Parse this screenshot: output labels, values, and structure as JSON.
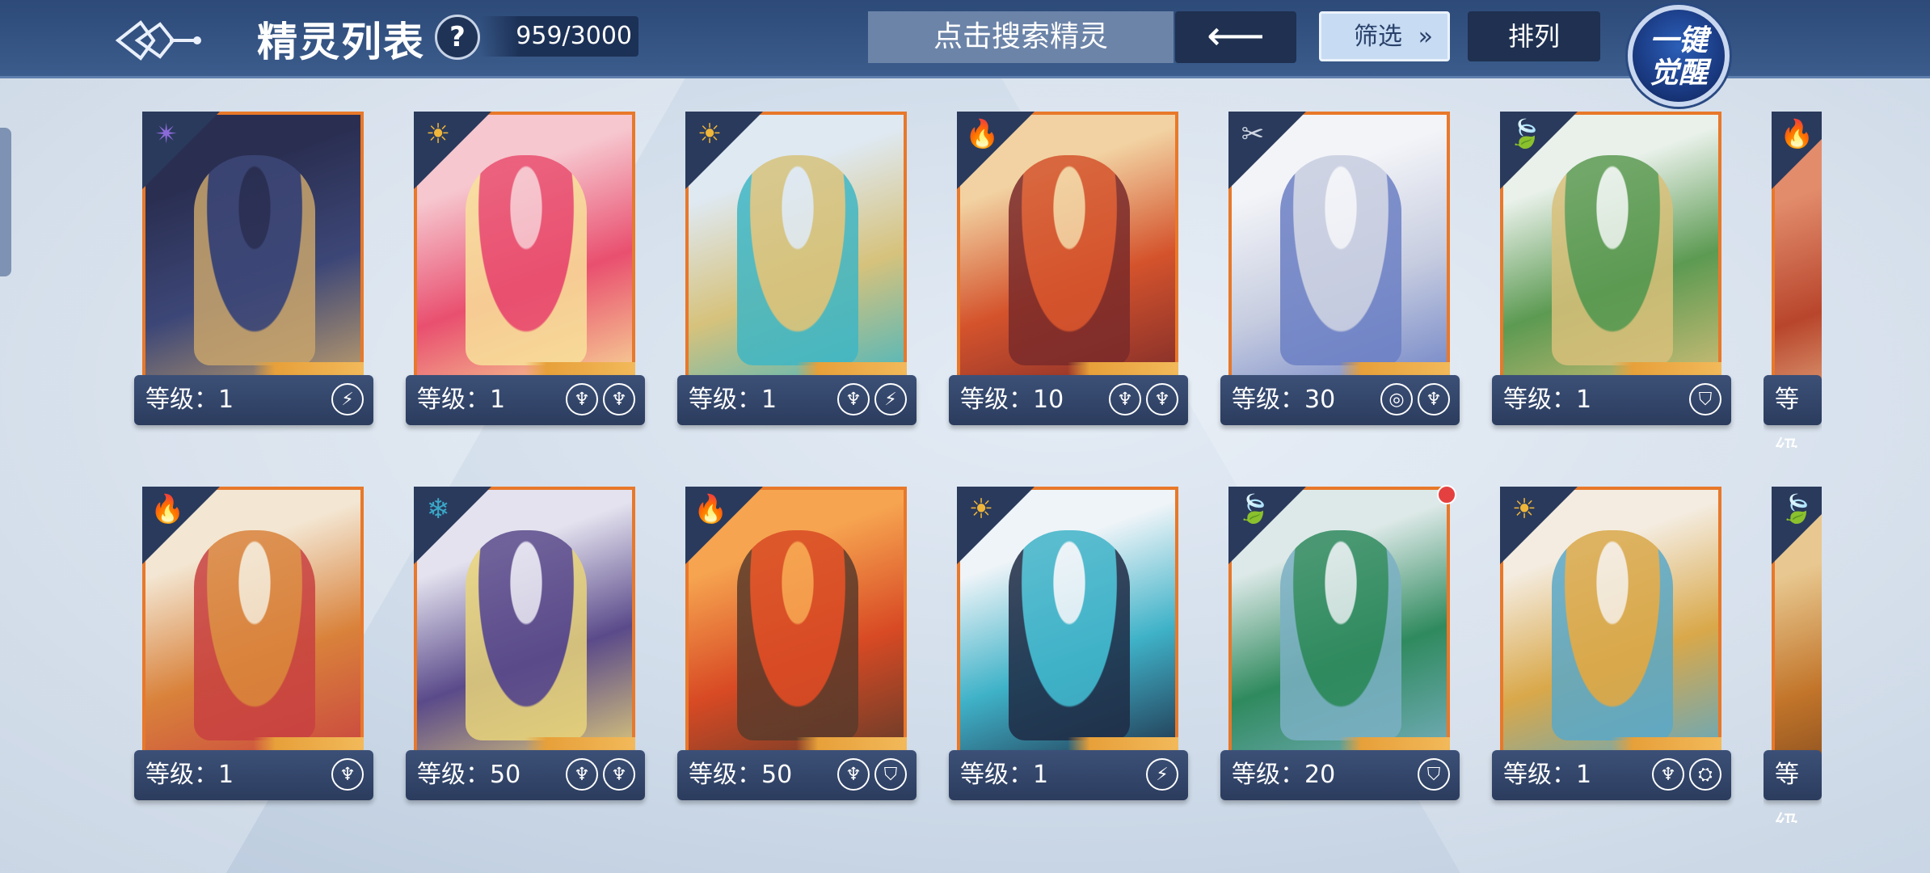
{
  "header": {
    "title": "精灵列表",
    "help": "?",
    "count": "959/3000",
    "search_placeholder": "点击搜索精灵",
    "back_arrow": "⟵",
    "filter": "筛选",
    "filter_icon": "chevron-double-down-icon",
    "sort": "排列",
    "awaken": "一键 觉醒"
  },
  "cards": [
    {
      "name": "card-fox-demon",
      "level": "等级：1",
      "element": "dark",
      "element_glyph": "✴",
      "art": [
        "#2a2f52",
        "#3d4777",
        "#c8a46b"
      ],
      "badges": [
        "⚡"
      ]
    },
    {
      "name": "card-pink-girl",
      "level": "等级：1",
      "element": "light",
      "element_glyph": "☀",
      "art": [
        "#f6c7cf",
        "#e94f6f",
        "#f8e19a"
      ],
      "badges": [
        "♆",
        "♆"
      ]
    },
    {
      "name": "card-white-dragon",
      "level": "等级：1",
      "element": "light",
      "element_glyph": "☀",
      "art": [
        "#dfe9f2",
        "#d6c27c",
        "#3fb6c4"
      ],
      "badges": [
        "♆",
        "⚡"
      ]
    },
    {
      "name": "card-red-warrior",
      "level": "等级：10",
      "element": "fire",
      "element_glyph": "🔥",
      "art": [
        "#f2d2a2",
        "#d4532c",
        "#7a2a2a"
      ],
      "badges": [
        "♆",
        "♆"
      ]
    },
    {
      "name": "card-white-elf",
      "level": "等级：30",
      "element": "neutral",
      "element_glyph": "✂",
      "art": [
        "#f3f4f8",
        "#c7cde0",
        "#6b7fc4"
      ],
      "badges": [
        "◎",
        "♆"
      ]
    },
    {
      "name": "card-green-dragon",
      "level": "等级：1",
      "element": "grass",
      "element_glyph": "🍃",
      "art": [
        "#e9f1ea",
        "#5c9a52",
        "#d9c07a"
      ],
      "badges": [
        "⛉"
      ]
    },
    {
      "name": "card-fire-partial-1",
      "level": "等级",
      "element": "fire",
      "element_glyph": "🔥",
      "art": [
        "#e28c6c",
        "#b8452c",
        "#f2d0a0"
      ],
      "badges": []
    },
    {
      "name": "card-fox-goggles",
      "level": "等级：1",
      "element": "fire",
      "element_glyph": "🔥",
      "art": [
        "#f3e6d2",
        "#d9823b",
        "#c84040"
      ],
      "badges": [
        "♆"
      ]
    },
    {
      "name": "card-purple-dragonman",
      "level": "等级：50",
      "element": "water",
      "element_glyph": "❄",
      "art": [
        "#e4e2ef",
        "#5a4a8a",
        "#e8d47a"
      ],
      "badges": [
        "♆",
        "♆"
      ]
    },
    {
      "name": "card-fire-boy",
      "level": "等级：50",
      "element": "fire",
      "element_glyph": "🔥",
      "art": [
        "#f6a450",
        "#d84a24",
        "#5a3a2a"
      ],
      "badges": [
        "♆",
        "⛉"
      ]
    },
    {
      "name": "card-hooded-boy",
      "level": "等级：1",
      "element": "light",
      "element_glyph": "☀",
      "art": [
        "#eef4f8",
        "#3fb2c8",
        "#1e2a44"
      ],
      "badges": [
        "⚡"
      ]
    },
    {
      "name": "card-green-elf",
      "level": "等级：20",
      "element": "grass",
      "element_glyph": "🍃",
      "art": [
        "#dde9e8",
        "#2f8a5e",
        "#7bb0c4"
      ],
      "badges": [
        "⛉"
      ]
    },
    {
      "name": "card-golden-knight",
      "level": "等级：1",
      "element": "light",
      "element_glyph": "☀",
      "art": [
        "#f4ece0",
        "#d9a84a",
        "#5aa8c8"
      ],
      "badges": [
        "♆",
        "⛭"
      ]
    },
    {
      "name": "card-grass-partial-2",
      "level": "等级",
      "element": "grass",
      "element_glyph": "🍃",
      "art": [
        "#e8c890",
        "#c2752a",
        "#6a3a1a"
      ],
      "badges": []
    }
  ],
  "colors": {
    "card_border": "#e8782a",
    "card_footer": "#2b3c5e",
    "topbar": "#2d4a78",
    "fire": "#e84a3a",
    "light": "#f0b63a",
    "dark": "#8a6ad8",
    "grass": "#6ac24a",
    "water": "#3aa8c8",
    "neutral": "#cfd6e2",
    "red_dot": "#e54040"
  }
}
